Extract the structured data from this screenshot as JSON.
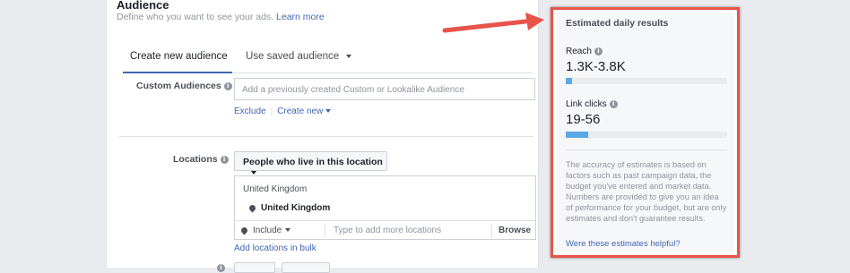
{
  "audience": {
    "title": "Audience",
    "description": "Define who you want to see your ads.",
    "learn_more": "Learn more"
  },
  "tabs": [
    {
      "label": "Create new audience",
      "active": true
    },
    {
      "label": "Use saved audience",
      "active": false
    }
  ],
  "custom_audiences": {
    "label": "Custom Audiences",
    "placeholder": "Add a previously created Custom or Lookalike Audience",
    "exclude": "Exclude",
    "create_new": "Create new"
  },
  "locations": {
    "label": "Locations",
    "dropdown": "People who live in this location",
    "header": "United Kingdom",
    "selected": "United Kingdom",
    "include": "Include",
    "placeholder": "Type to add more locations",
    "browse": "Browse",
    "bulk": "Add locations in bulk"
  },
  "estimates": {
    "title": "Estimated daily results",
    "reach_label": "Reach",
    "reach_value": "1.3K-3.8K",
    "reach_fill": 0.04,
    "clicks_label": "Link clicks",
    "clicks_value": "19-56",
    "clicks_fill": 0.14,
    "note": "The accuracy of estimates is based on factors such as past campaign data, the budget you've entered and market data. Numbers are provided to give you an idea of performance for your budget, but are only estimates and don't guarantee results.",
    "helpful": "Were these estimates helpful?"
  },
  "colors": {
    "accent": "#4267b2",
    "bar": "#5ba8e6",
    "highlight": "#e8534a"
  }
}
